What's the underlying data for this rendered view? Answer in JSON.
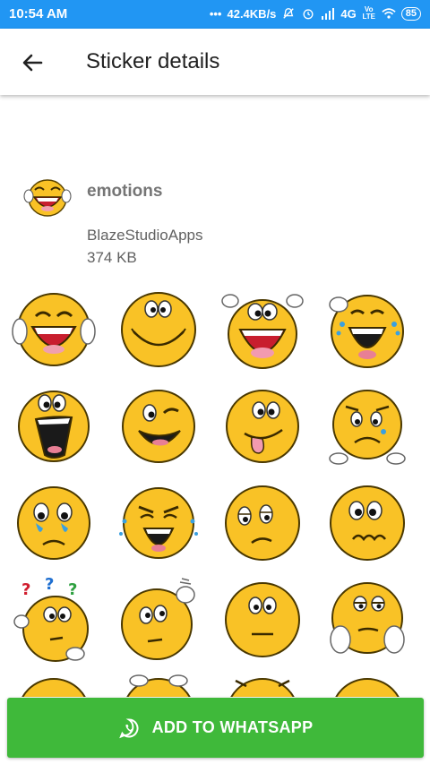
{
  "status_bar": {
    "time": "10:54 AM",
    "dots": "•••",
    "network_speed": "42.4KB/s",
    "signal": "4G",
    "volte": "Vo LTE",
    "battery": "85"
  },
  "app_bar": {
    "title": "Sticker details",
    "back_icon": "arrow-left-icon"
  },
  "pack": {
    "name": "emotions",
    "publisher": "BlazeStudioApps",
    "size": "374 KB"
  },
  "stickers": [
    {
      "mood": "laughing-thumbs-up"
    },
    {
      "mood": "smiling"
    },
    {
      "mood": "excited-hands-up"
    },
    {
      "mood": "crying-laughing"
    },
    {
      "mood": "shouting"
    },
    {
      "mood": "winking"
    },
    {
      "mood": "tongue-out"
    },
    {
      "mood": "sad-peeking"
    },
    {
      "mood": "crying"
    },
    {
      "mood": "tearful-laughing"
    },
    {
      "mood": "sorrowful"
    },
    {
      "mood": "worried"
    },
    {
      "mood": "confused-question-marks"
    },
    {
      "mood": "thinking"
    },
    {
      "mood": "neutral"
    },
    {
      "mood": "bored-hands-on-face"
    }
  ],
  "add_button": {
    "label": "ADD TO WHATSAPP",
    "icon": "whatsapp-icon"
  },
  "colors": {
    "status_bar": "#2196F3",
    "button": "#3fb93a",
    "emoji_yellow": "#F9C226"
  }
}
